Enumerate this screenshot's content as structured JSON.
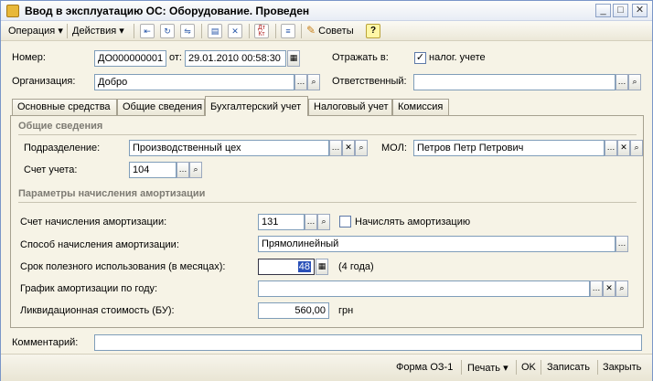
{
  "window": {
    "title": "Ввод в эксплуатацию ОС: Оборудование. Проведен",
    "controls": [
      "_",
      "□",
      "✕"
    ]
  },
  "toolbar": {
    "operation": "Операция",
    "actions": "Действия",
    "dt_kt_top": "Дт",
    "dt_kt_bottom": "Кт",
    "advice": "Советы",
    "help": "?"
  },
  "header": {
    "number_label": "Номер:",
    "number_value": "ДО000000001",
    "date_label": "от:",
    "date_value": "29.01.2010 00:58:30",
    "reflect_label": "Отражать в:",
    "tax_accounting_label": "налог. учете",
    "tax_accounting_checked": true,
    "org_label": "Организация:",
    "org_value": "Добро",
    "responsible_label": "Ответственный:",
    "responsible_value": ""
  },
  "tabs": [
    {
      "label": "Основные средства",
      "active": false
    },
    {
      "label": "Общие сведения",
      "active": false
    },
    {
      "label": "Бухгалтерский учет",
      "active": true
    },
    {
      "label": "Налоговый учет",
      "active": false
    },
    {
      "label": "Комиссия",
      "active": false
    }
  ],
  "accounting": {
    "general_title": "Общие сведения",
    "division_label": "Подразделение:",
    "division_value": "Производственный цех",
    "mol_label": "МОЛ:",
    "mol_value": "Петров Петр Петрович",
    "account_label": "Счет учета:",
    "account_value": "104",
    "amort_title": "Параметры начисления амортизации",
    "amort_account_label": "Счет начисления амортизации:",
    "amort_account_value": "131",
    "charge_amort_label": "Начислять амортизацию",
    "charge_amort_checked": false,
    "method_label": "Способ начисления амортизации:",
    "method_value": "Прямолинейный",
    "useful_life_label": "Срок полезного использования (в месяцах):",
    "useful_life_value": "48",
    "useful_life_note": "(4 года)",
    "schedule_label": "График амортизации по году:",
    "schedule_value": "",
    "liquidation_label": "Ликвидационная стоимость (БУ):",
    "liquidation_value": "560,00",
    "liquidation_currency": "грн"
  },
  "comment": {
    "label": "Комментарий:",
    "value": ""
  },
  "footer": {
    "form_os1": "Форма ОЗ-1",
    "print": "Печать",
    "ok": "OK",
    "save": "Записать",
    "close": "Закрыть"
  }
}
